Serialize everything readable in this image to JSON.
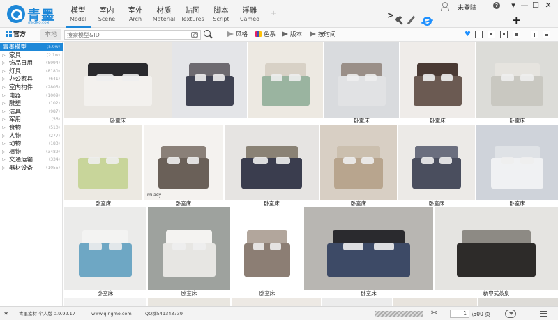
{
  "app": {
    "name": "青墨",
    "subname": "QINGMO.COM"
  },
  "categories": [
    {
      "zh": "模型",
      "en": "Model",
      "active": true
    },
    {
      "zh": "室内",
      "en": "Scene",
      "active": false
    },
    {
      "zh": "室外",
      "en": "Arch",
      "active": false
    },
    {
      "zh": "材质",
      "en": "Material",
      "active": false
    },
    {
      "zh": "贴图",
      "en": "Textures",
      "active": false
    },
    {
      "zh": "脚本",
      "en": "Script",
      "active": false
    },
    {
      "zh": "浮雕",
      "en": "Cameo",
      "active": false
    }
  ],
  "add_category": "+",
  "user": {
    "name": "未登陆"
  },
  "window": {
    "menu": "▾",
    "minimize": "—",
    "maximize": "☐",
    "close": "✕"
  },
  "tools": {
    "arrow": ">",
    "plus": "+"
  },
  "library": {
    "online_label": "官方",
    "local_label": "本地"
  },
  "search": {
    "placeholder": "搜索模型&ID"
  },
  "filters": [
    {
      "label": "风格",
      "icon": "style-icon"
    },
    {
      "label": "色系",
      "icon": "color-icon"
    },
    {
      "label": "版本",
      "icon": "version-icon"
    },
    {
      "label": "按时间",
      "icon": "time-icon"
    }
  ],
  "favorite_icon": "heart-icon",
  "sidebar": {
    "items": [
      {
        "label": "青墨模型",
        "count": "(5.0w)",
        "active": true,
        "expand": ""
      },
      {
        "label": "家具",
        "count": "(2.1w)",
        "active": false,
        "expand": "▷"
      },
      {
        "label": "饰品日用",
        "count": "(8994)",
        "active": false,
        "expand": "▷"
      },
      {
        "label": "灯具",
        "count": "(8180)",
        "active": false,
        "expand": "▷"
      },
      {
        "label": "办公家具",
        "count": "(641)",
        "active": false,
        "expand": "▷"
      },
      {
        "label": "室内构件",
        "count": "(2805)",
        "active": false,
        "expand": "▷"
      },
      {
        "label": "电器",
        "count": "(1009)",
        "active": false,
        "expand": "▷"
      },
      {
        "label": "雕塑",
        "count": "(102)",
        "active": false,
        "expand": "▷"
      },
      {
        "label": "洁具",
        "count": "(987)",
        "active": false,
        "expand": "▷"
      },
      {
        "label": "军用",
        "count": "(56)",
        "active": false,
        "expand": "▷"
      },
      {
        "label": "食物",
        "count": "(510)",
        "active": false,
        "expand": "▷"
      },
      {
        "label": "人物",
        "count": "(277)",
        "active": false,
        "expand": "▷"
      },
      {
        "label": "动物",
        "count": "(183)",
        "active": false,
        "expand": "▷"
      },
      {
        "label": "植物",
        "count": "(3489)",
        "active": false,
        "expand": "▷"
      },
      {
        "label": "交通运输",
        "count": "(334)",
        "active": false,
        "expand": "▷"
      },
      {
        "label": "器材设备",
        "count": "(1055)",
        "active": false,
        "expand": "▷"
      }
    ]
  },
  "tiles_row1": [
    {
      "caption": "卧室床",
      "bg": "#e9e6e1",
      "bed": "#f3f1ee",
      "head": "#2a2a2e"
    },
    {
      "caption": "",
      "bg": "#e4e5e8",
      "bed": "#3f4252",
      "head": "#6d6a70"
    },
    {
      "caption": "",
      "bg": "#ede9e2",
      "bed": "#9ab4a0",
      "head": "#d8d1c6"
    },
    {
      "caption": "卧室床",
      "bg": "#d9dbde",
      "bed": "#e1e2e4",
      "head": "#9a8f88"
    },
    {
      "caption": "卧室床",
      "bg": "#efece9",
      "bed": "#6b5a52",
      "head": "#4a3a34"
    },
    {
      "caption": "卧室床",
      "bg": "#dcdcd8",
      "bed": "#c9c8c1",
      "head": "#e6e4df"
    }
  ],
  "tiles_row2": [
    {
      "caption": "卧室床",
      "bg": "#ece9e2",
      "bed": "#c8d59a",
      "head": "#ece9e2"
    },
    {
      "caption": "卧室床",
      "bg": "#f4f2ef",
      "bed": "#6a6058",
      "head": "#8a8078",
      "watermark": "milady"
    },
    {
      "caption": "卧室床",
      "bg": "#e6e4e2",
      "bed": "#3a3d4e",
      "head": "#8a8275"
    },
    {
      "caption": "卧室床",
      "bg": "#d8cfc4",
      "bed": "#b8a58e",
      "head": "#cbbfae"
    },
    {
      "caption": "卧室床",
      "bg": "#eceae7",
      "bed": "#4a4e5e",
      "head": "#6a6e7e"
    },
    {
      "caption": "卧室床",
      "bg": "#cfd3da",
      "bed": "#f0f1f3",
      "head": "#dfe2e6"
    }
  ],
  "tiles_row3": [
    {
      "caption": "卧室床",
      "bg": "#ebebea",
      "bed": "#6ea7c4",
      "head": "#f3f3f2"
    },
    {
      "caption": "卧室床",
      "bg": "#9ea29e",
      "bed": "#e7e6e3",
      "head": "#f4f3f1"
    },
    {
      "caption": "卧室床",
      "bg": "#ffffff",
      "bed": "#8c7e74",
      "head": "#b2a69c"
    },
    {
      "caption": "卧室床",
      "bg": "#b8b6b2",
      "bed": "#3d4a66",
      "head": "#2a2a2e"
    },
    {
      "caption": "新中式茶桌",
      "bg": "#e5e4e1",
      "bed": "#2d2b29",
      "head": "#8d8a84"
    }
  ],
  "status": {
    "app_version": "青墨素材-个人版 0.9.92.17",
    "website": "www.qingmo.com",
    "qq": "QQ群541343739",
    "page_current": "1",
    "page_total": "\\500 页"
  }
}
